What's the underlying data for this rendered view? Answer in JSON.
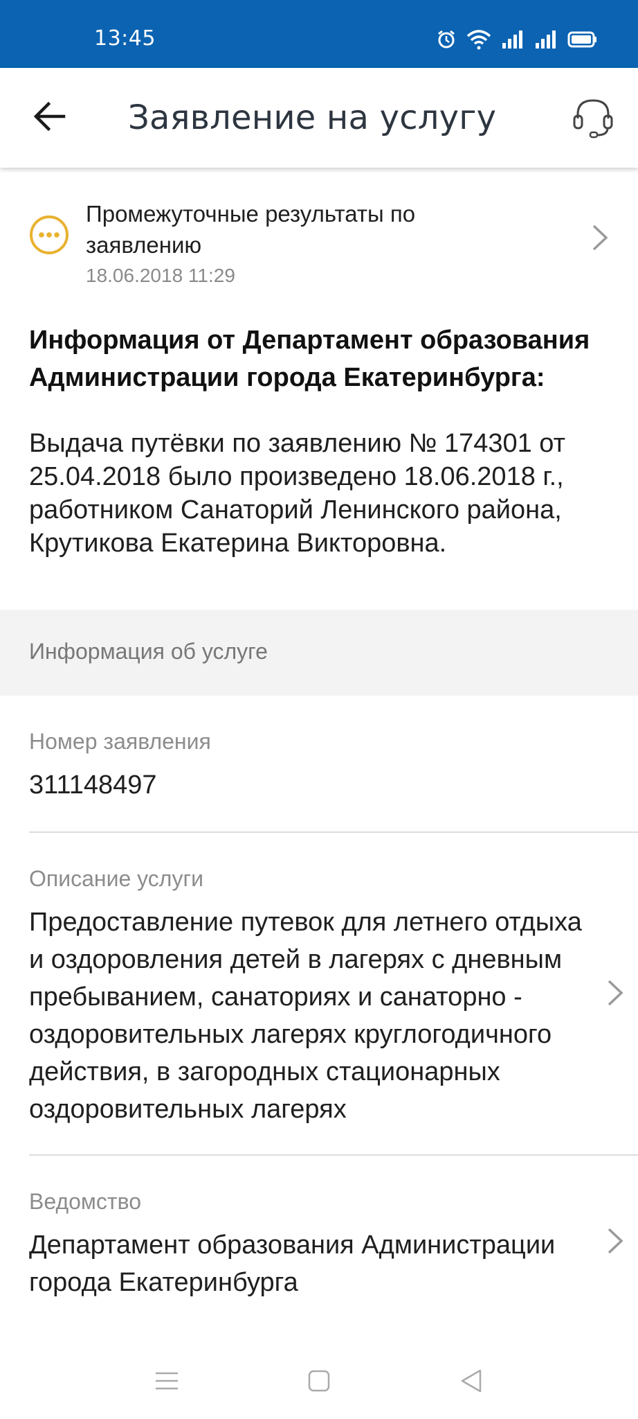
{
  "status_bar": {
    "time": "13:45",
    "icons": [
      "alarm-icon",
      "wifi-icon",
      "signal-icon",
      "signal-icon",
      "battery-icon"
    ],
    "background_color": "#0b63b2"
  },
  "app_bar": {
    "title": "Заявление на услугу",
    "back_icon": "arrow-left-icon",
    "support_icon": "headset-icon"
  },
  "result": {
    "title": "Промежуточные результаты по заявлению",
    "date": "18.06.2018 11:29",
    "icon": "pending-dots-icon",
    "icon_color": "#e8b230"
  },
  "info": {
    "heading": "Информация от Департамент образования Администрации города Екатеринбурга:",
    "text": "Выдача путёвки по заявлению № 174301 от 25.04.2018 было произведено 18.06.2018 г., работником Санаторий Ленинского района, Крутикова Екатерина Викторовна."
  },
  "service_section": {
    "header": "Информация об услуге",
    "fields": [
      {
        "label": "Номер заявления",
        "value": "311148497"
      },
      {
        "label": "Описание услуги",
        "value": "Предоставление путевок для летнего отдыха и оздоровления детей в лагерях с дневным пребыванием, санаториях и санаторно - оздоровительных лагерях круглогодичного действия, в загородных стационарных оздоровительных лагерях"
      },
      {
        "label": "Ведомство",
        "value": "Департамент образования Администрации города Екатеринбурга"
      }
    ]
  },
  "nav_bar": {
    "icons": [
      "menu-icon",
      "home-square-icon",
      "back-triangle-icon"
    ]
  }
}
